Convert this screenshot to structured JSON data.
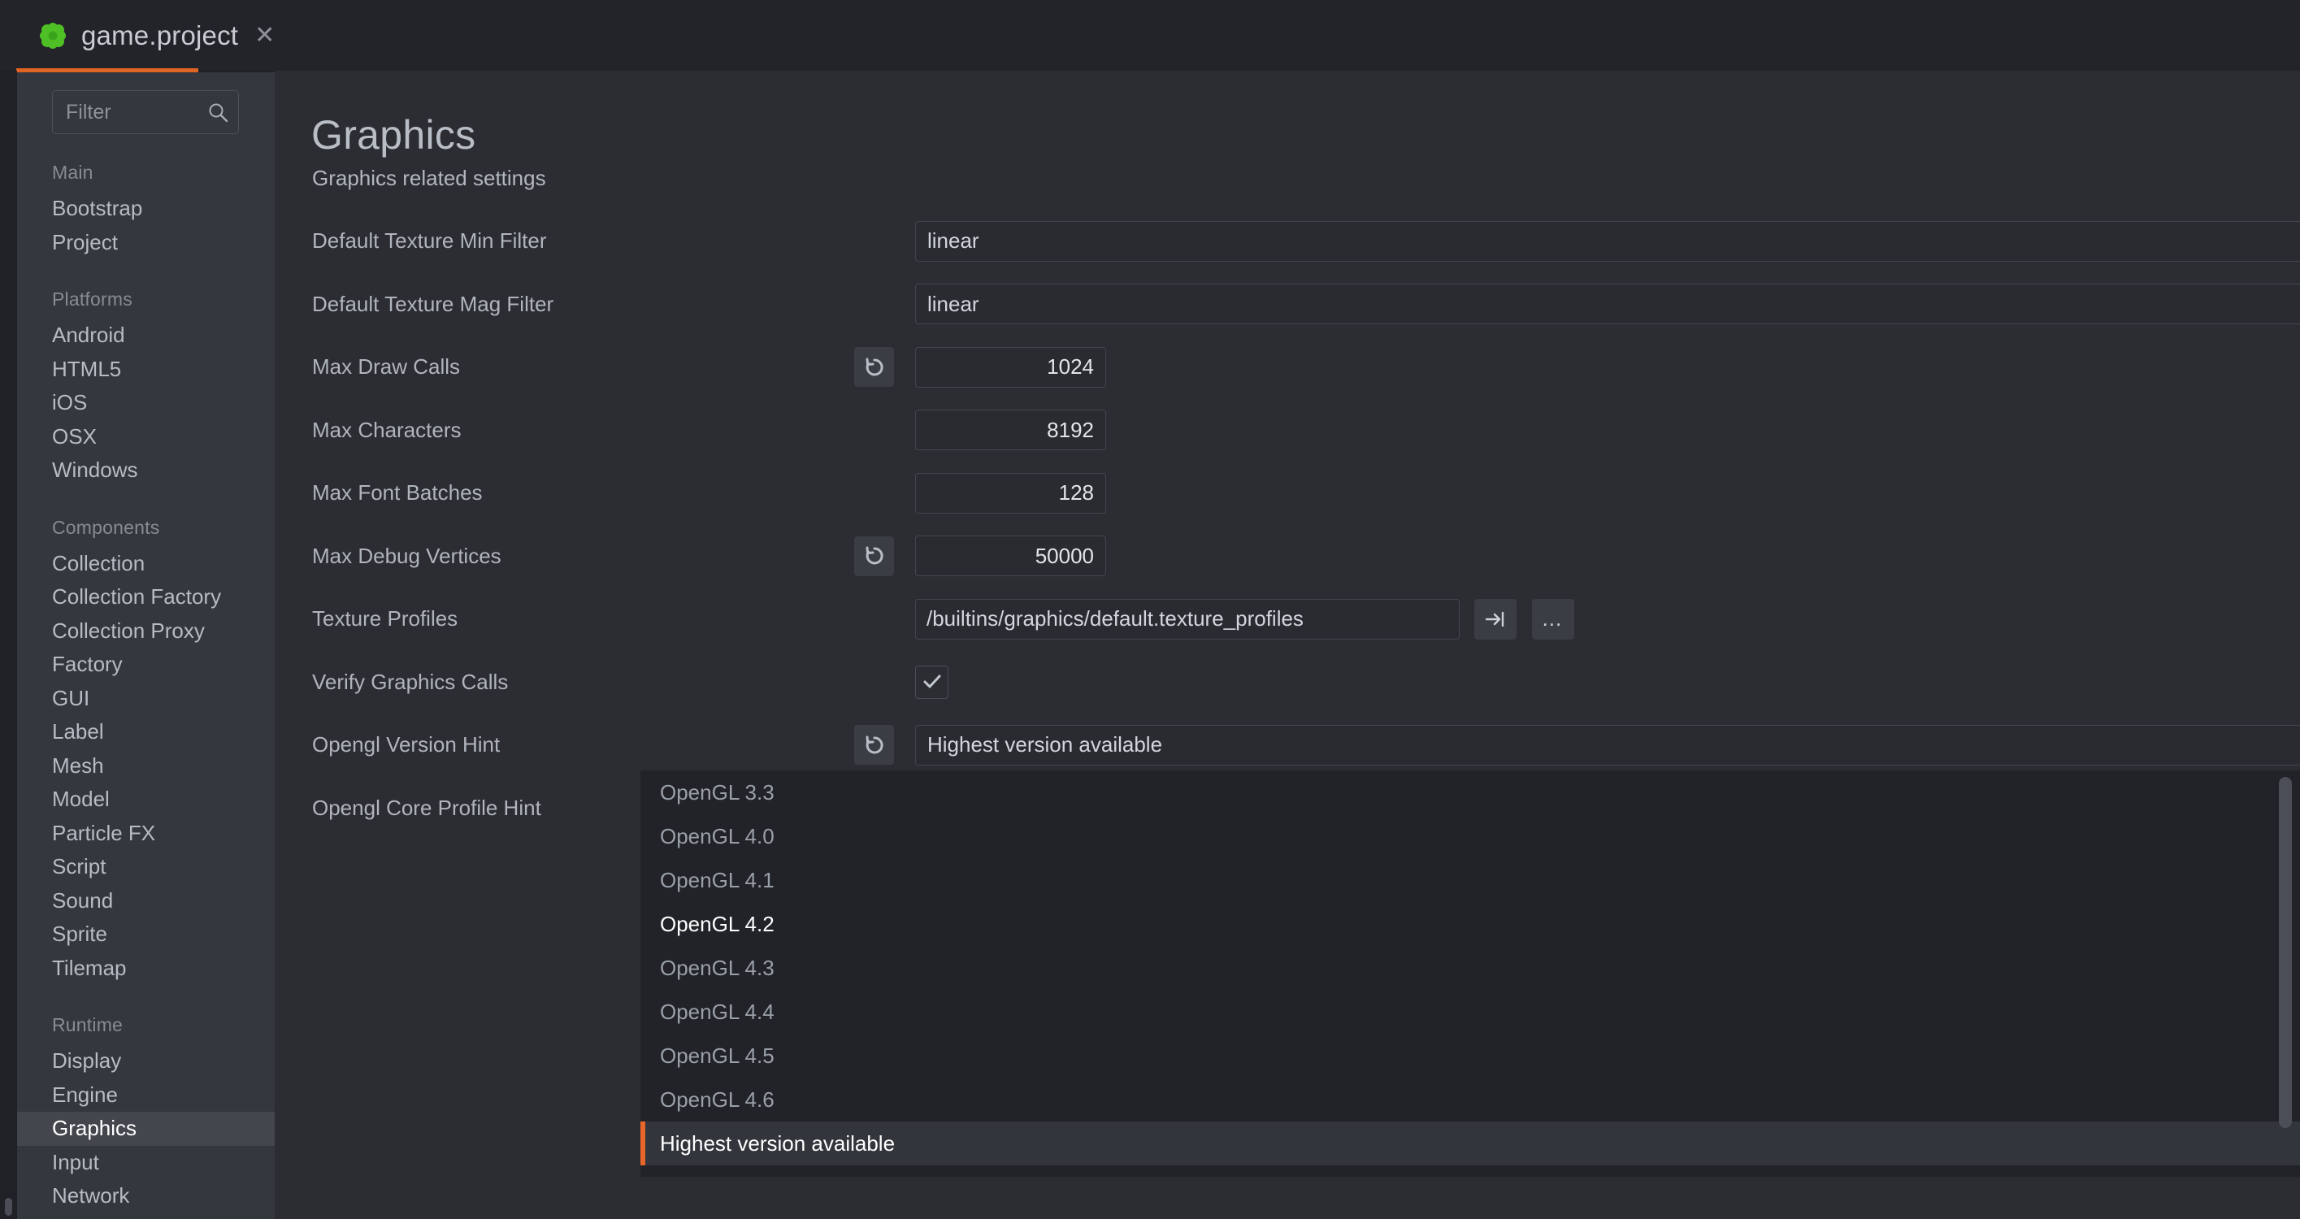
{
  "tab": {
    "title": "game.project",
    "icon": "defold-logo-icon",
    "close_label": "✕",
    "accent_color": "#e06424"
  },
  "sidebar": {
    "filter": {
      "placeholder": "Filter",
      "value": "",
      "icon": "search-icon"
    },
    "groups": [
      {
        "label": "Main",
        "items": [
          "Bootstrap",
          "Project"
        ]
      },
      {
        "label": "Platforms",
        "items": [
          "Android",
          "HTML5",
          "iOS",
          "OSX",
          "Windows"
        ]
      },
      {
        "label": "Components",
        "items": [
          "Collection",
          "Collection Factory",
          "Collection Proxy",
          "Factory",
          "GUI",
          "Label",
          "Mesh",
          "Model",
          "Particle FX",
          "Script",
          "Sound",
          "Sprite",
          "Tilemap"
        ]
      },
      {
        "label": "Runtime",
        "items": [
          "Display",
          "Engine",
          "Graphics",
          "Input",
          "Network"
        ]
      }
    ],
    "selected_item": "Graphics"
  },
  "main": {
    "title": "Graphics",
    "subtitle": "Graphics related settings",
    "fields": [
      {
        "label": "Default Texture Min Filter",
        "type": "select",
        "value": "linear",
        "reset": false,
        "arrow": "chevron-down-icon"
      },
      {
        "label": "Default Texture Mag Filter",
        "type": "select",
        "value": "linear",
        "reset": false,
        "arrow": "chevron-down-icon"
      },
      {
        "label": "Max Draw Calls",
        "type": "number",
        "value": "1024",
        "reset": true
      },
      {
        "label": "Max Characters",
        "type": "number",
        "value": "8192",
        "reset": false
      },
      {
        "label": "Max Font Batches",
        "type": "number",
        "value": "128",
        "reset": false
      },
      {
        "label": "Max Debug Vertices",
        "type": "number",
        "value": "50000",
        "reset": true
      },
      {
        "label": "Texture Profiles",
        "type": "path",
        "value": "/builtins/graphics/default.texture_profiles",
        "reset": false,
        "buttons": [
          "goto-resource-icon",
          "browse-icon"
        ],
        "browse_label": "…"
      },
      {
        "label": "Verify Graphics Calls",
        "type": "checkbox",
        "checked": true,
        "reset": false
      },
      {
        "label": "Opengl Version Hint",
        "type": "select-open",
        "value": "Highest version available",
        "reset": true,
        "arrow": "chevron-up-icon"
      },
      {
        "label": "Opengl Core Profile Hint",
        "type": "hidden-behind-dropdown"
      }
    ]
  },
  "dropdown": {
    "open": true,
    "options": [
      "OpenGL 3.3",
      "OpenGL 4.0",
      "OpenGL 4.1",
      "OpenGL 4.2",
      "OpenGL 4.3",
      "OpenGL 4.4",
      "OpenGL 4.5",
      "OpenGL 4.6",
      "Highest version available"
    ],
    "hovered": "OpenGL 4.2",
    "selected": "Highest version available",
    "selected_marker_color": "#e8662a"
  }
}
